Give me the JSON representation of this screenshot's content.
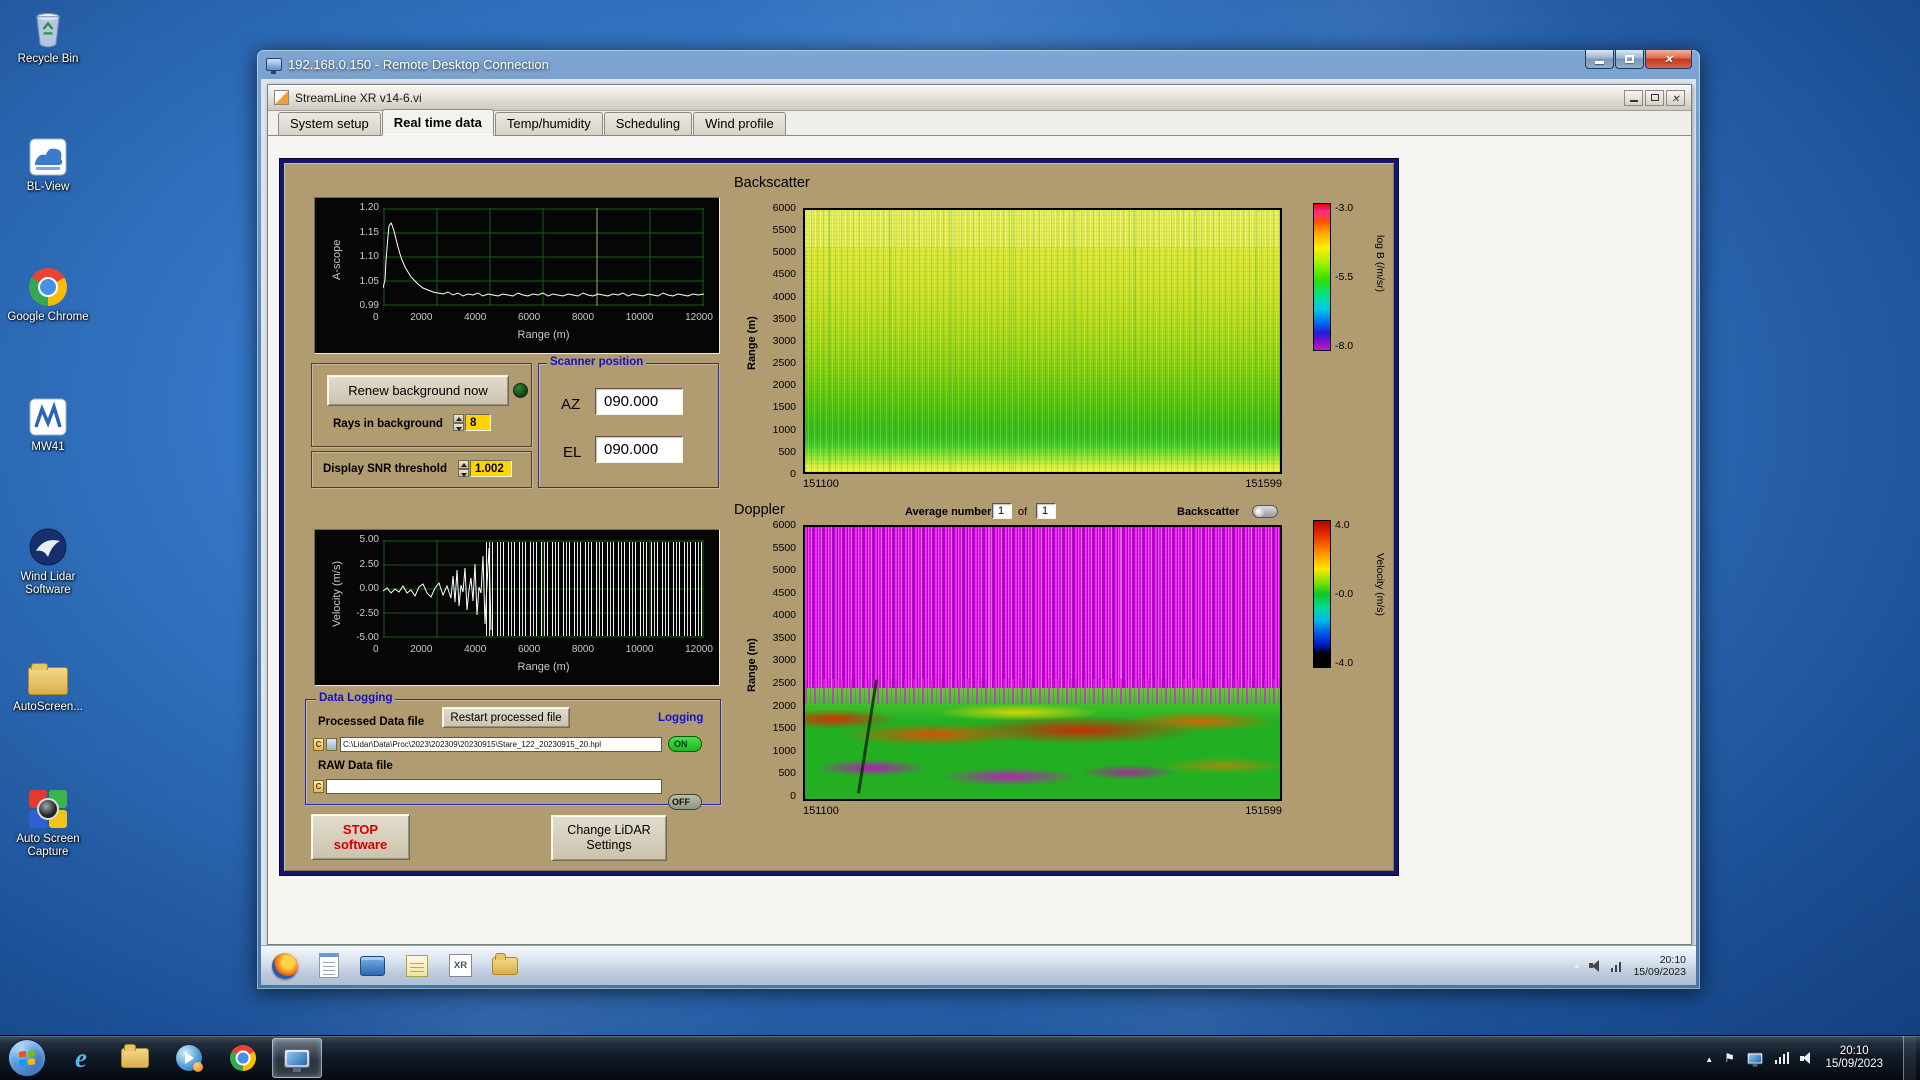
{
  "desktop": {
    "icons": [
      {
        "label": "Recycle Bin"
      },
      {
        "label": "BL-View"
      },
      {
        "label": "Google Chrome"
      },
      {
        "label": "MW41"
      },
      {
        "label": "Wind Lidar Software"
      },
      {
        "label": "AutoScreen..."
      },
      {
        "label": "Auto Screen Capture"
      }
    ]
  },
  "taskbar": {
    "time": "20:10",
    "date": "15/09/2023",
    "ie_glyph": "e"
  },
  "rdp": {
    "title": "192.168.0.150 - Remote Desktop Connection",
    "remote_taskbar": {
      "time": "20:10",
      "date": "15/09/2023",
      "xr_label": "XR"
    }
  },
  "app": {
    "title": "StreamLine XR v14-6.vi",
    "tabs": [
      "System setup",
      "Real time data",
      "Temp/humidity",
      "Scheduling",
      "Wind profile"
    ],
    "active_tab": "Real time data"
  },
  "ascope": {
    "ylabel": "A-scope",
    "xlabel": "Range (m)",
    "yticks": [
      "1.20",
      "1.15",
      "1.10",
      "1.05",
      "0.99"
    ],
    "xticks": [
      "0",
      "2000",
      "4000",
      "6000",
      "8000",
      "10000",
      "12000"
    ]
  },
  "background_controls": {
    "renew_button": "Renew background now",
    "rays_label": "Rays in background",
    "rays_value": "8",
    "snr_label": "Display SNR threshold",
    "snr_value": "1.002"
  },
  "scanner": {
    "title": "Scanner position",
    "az_label": "AZ",
    "az_value": "090.000",
    "el_label": "EL",
    "el_value": "090.000"
  },
  "backscatter": {
    "title": "Backscatter",
    "ylabel": "Range (m)",
    "yticks": [
      "6000",
      "5500",
      "5000",
      "4500",
      "4000",
      "3500",
      "3000",
      "2500",
      "2000",
      "1500",
      "1000",
      "500",
      "0"
    ],
    "x_left": "151100",
    "x_right": "151599",
    "colorbar_label": "log B (/m/sr)",
    "colorbar_ticks": [
      "-3.0",
      "-5.5",
      "-8.0"
    ]
  },
  "doppler": {
    "title": "Doppler",
    "avg_label": "Average number",
    "avg_value": "1",
    "of_label": "of",
    "avg_total": "1",
    "toggle_label": "Backscatter",
    "ylabel": "Range (m)",
    "yticks": [
      "6000",
      "5500",
      "5000",
      "4500",
      "4000",
      "3500",
      "3000",
      "2500",
      "2000",
      "1500",
      "1000",
      "500",
      "0"
    ],
    "x_left": "151100",
    "x_right": "151599",
    "colorbar_label": "Velocity (m/s)",
    "colorbar_ticks": [
      "4.0",
      "-0.0",
      "-4.0"
    ]
  },
  "velocity": {
    "ylabel": "Velocity (m/s)",
    "xlabel": "Range (m)",
    "yticks": [
      "5.00",
      "2.50",
      "0.00",
      "-2.50",
      "-5.00"
    ],
    "xticks": [
      "0",
      "2000",
      "4000",
      "6000",
      "8000",
      "10000",
      "12000"
    ]
  },
  "logging": {
    "title": "Data Logging",
    "logging_label": "Logging",
    "processed_label": "Processed Data file",
    "restart_button": "Restart processed file",
    "processed_path": "C:\\Lidar\\Data\\Proc\\2023\\202309\\20230915\\Stare_122_20230915_20.hpl",
    "processed_state": "ON",
    "raw_label": "RAW Data file",
    "raw_path": "",
    "raw_state": "OFF",
    "drive_label": "C"
  },
  "actions": {
    "stop_line1": "STOP",
    "stop_line2": "software",
    "change_line1": "Change LiDAR",
    "change_line2": "Settings"
  }
}
